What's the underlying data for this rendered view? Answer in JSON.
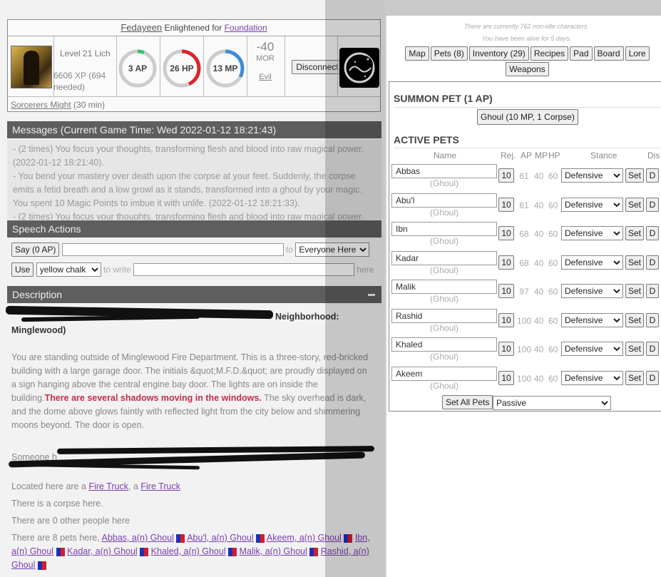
{
  "character": {
    "name": "Fedayeen",
    "enlightened_text": "Enlightened for",
    "faction": "Foundation",
    "level": "Level 21 Lich",
    "xp": "6606 XP (694 needed)",
    "ap": "3 AP",
    "ap_fraction": 0.06,
    "hp": "26 HP",
    "hp_fraction": 0.43,
    "mp": "13 MP",
    "mp_fraction": 0.33,
    "morality": "-40",
    "morality_label": "MOR",
    "alignment": "Evil",
    "disconnect_label": "Disconnect",
    "buff_name": "Sorcerers Might",
    "buff_duration": "(30 min)"
  },
  "messages": {
    "header": "Messages (Current Game Time: Wed 2022-01-12 18:21:43)",
    "items": [
      "- (2 times) You focus your thoughts, transforming flesh and blood into raw magical power. (2022-01-12 18:21:40).",
      "- You bend your mastery over death upon the corpse at your feet. Suddenly, the corpse emits a fetid breath and a low growl as it stands, transformed into a ghoul by your magic. You spent 10 Magic Points to imbue it with unlife. (2022-01-12 18:21:33).",
      "- (2 times) You focus your thoughts, transforming flesh and blood into raw magical power."
    ]
  },
  "speech": {
    "header": "Speech Actions",
    "say_label": "Say (0 AP)",
    "to_label": "to",
    "target": "Everyone Here",
    "use_label": "Use",
    "item": "yellow chalk",
    "to_write_label": "to write",
    "here_label": "here"
  },
  "description": {
    "header": "Description",
    "collapse_glyph": "▬",
    "location_tail": "Neighborhood:",
    "location_neighborhood": "Minglewood)",
    "text_main": "You are standing outside of Minglewood Fire Department. This is a three-story, red-bricked building with a large garage door. The initials &quot;M.F.D.&quot; are proudly displayed on a sign hanging above the central engine bay door. The lights are on inside the building.",
    "text_red": "There are several shadows moving in the windows.",
    "text_after": "The sky overhead is dark, and the dome above glows faintly with reflected light from the city below and shimmering moons beyond. The door is open.",
    "someone_prefix": "Someone h",
    "located_prefix": "Located here are a",
    "vehicle1": "Fire Truck",
    "comma_a": ", a",
    "vehicle2": "Fire Truck",
    "corpse": "There is a corpse here.",
    "people": "There are 0 other people here",
    "pets_prefix": "There are 8 pets here,",
    "pet_links": [
      "Abbas, a(n) Ghoul",
      "Abu'l, a(n) Ghoul",
      "Akeem, a(n) Ghoul",
      "Ibn, a(n) Ghoul",
      "Kadar, a(n) Ghoul",
      "Khaled, a(n) Ghoul",
      "Malik, a(n) Ghoul",
      "Rashid, a(n) Ghoul"
    ]
  },
  "online": {
    "line1": "There are currently 762 non-idle characters.",
    "line2": "You have been alive for 5 days."
  },
  "nav": [
    "Map",
    "Pets (8)",
    "Inventory (29)",
    "Recipes",
    "Pad",
    "Board",
    "Lore",
    "Weapons"
  ],
  "summon": {
    "header": "SUMMON PET (1 AP)",
    "button": "Ghoul (10 MP, 1 Corpse)"
  },
  "active_pets": {
    "header": "ACTIVE PETS",
    "columns": {
      "name": "Name",
      "rej": "Rej.",
      "ap": "AP",
      "mp": "MP",
      "hp": "HP",
      "stance": "Stance",
      "dis": "Dis"
    },
    "rows": [
      {
        "name": "Abbas",
        "kind": "(Ghoul)",
        "rej": "10",
        "ap": "61",
        "mp": "40",
        "hp": "60",
        "stance": "Defensive",
        "set": "Set",
        "d": "D"
      },
      {
        "name": "Abu'l",
        "kind": "(Ghoul)",
        "rej": "10",
        "ap": "61",
        "mp": "40",
        "hp": "60",
        "stance": "Defensive",
        "set": "Set",
        "d": "D"
      },
      {
        "name": "Ibn",
        "kind": "(Ghoul)",
        "rej": "10",
        "ap": "68",
        "mp": "40",
        "hp": "60",
        "stance": "Defensive",
        "set": "Set",
        "d": "D"
      },
      {
        "name": "Kadar",
        "kind": "(Ghoul)",
        "rej": "10",
        "ap": "68",
        "mp": "40",
        "hp": "60",
        "stance": "Defensive",
        "set": "Set",
        "d": "D"
      },
      {
        "name": "Malik",
        "kind": "(Ghoul)",
        "rej": "10",
        "ap": "97",
        "mp": "40",
        "hp": "60",
        "stance": "Defensive",
        "set": "Set",
        "d": "D"
      },
      {
        "name": "Rashid",
        "kind": "(Ghoul)",
        "rej": "10",
        "ap": "100",
        "mp": "40",
        "hp": "60",
        "stance": "Defensive",
        "set": "Set",
        "d": "D"
      },
      {
        "name": "Khaled",
        "kind": "(Ghoul)",
        "rej": "10",
        "ap": "100",
        "mp": "40",
        "hp": "60",
        "stance": "Defensive",
        "set": "Set",
        "d": "D"
      },
      {
        "name": "Akeem",
        "kind": "(Ghoul)",
        "rej": "10",
        "ap": "100",
        "mp": "40",
        "hp": "60",
        "stance": "Defensive",
        "set": "Set",
        "d": "D"
      }
    ],
    "set_all_label": "Set All Pets",
    "set_all_value": "Passive"
  },
  "colors": {
    "ap_ring": "#3fbf6a",
    "hp_ring": "#d9262b",
    "mp_ring": "#3b8fd6",
    "ring_bg": "#cccccc",
    "red_text": "#c0304a"
  }
}
